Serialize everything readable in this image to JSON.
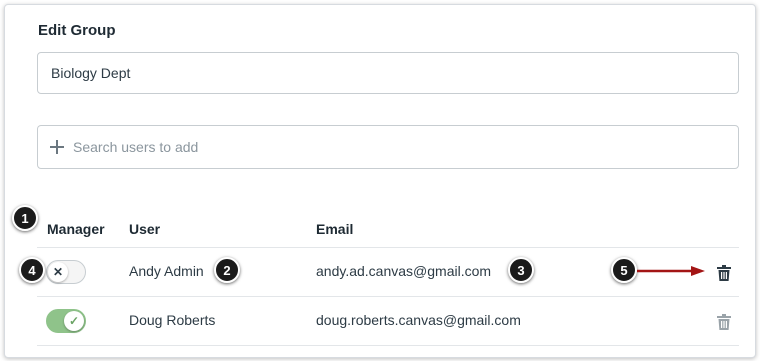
{
  "dialog": {
    "title": "Edit Group",
    "group_name_value": "Biology Dept",
    "search_placeholder": "Search users to add"
  },
  "table": {
    "headers": {
      "manager": "Manager",
      "user": "User",
      "email": "Email"
    },
    "rows": [
      {
        "manager": false,
        "user": "Andy Admin",
        "email": "andy.ad.canvas@gmail.com"
      },
      {
        "manager": true,
        "user": "Doug Roberts",
        "email": "doug.roberts.canvas@gmail.com"
      }
    ]
  },
  "annotations": {
    "badges": [
      "1",
      "2",
      "3",
      "4",
      "5"
    ],
    "arrow_color": "#a31515"
  },
  "icons": {
    "toggle_off_glyph": "✕",
    "toggle_on_glyph": "✓",
    "delete": "trash-icon",
    "add": "plus-icon"
  },
  "colors": {
    "toggle_on": "#8fc38a",
    "trash_active": "#2d3b45",
    "trash_inactive": "#9aa3a9"
  }
}
